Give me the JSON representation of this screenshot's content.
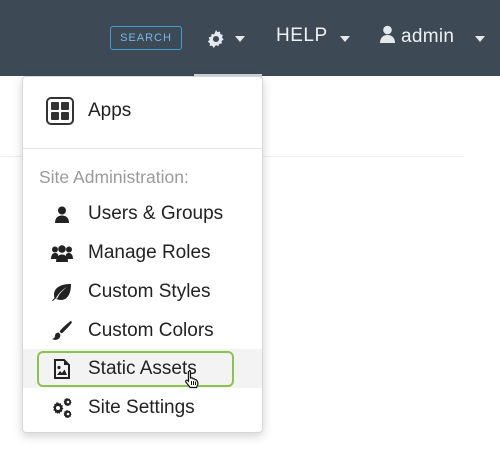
{
  "topbar": {
    "search_label": "SEARCH",
    "help_label": "HELP",
    "user_label": "admin"
  },
  "menu": {
    "apps_label": "Apps",
    "section_header": "Site Administration:",
    "items": [
      {
        "label": "Users & Groups",
        "icon": "user-icon"
      },
      {
        "label": "Manage Roles",
        "icon": "users-icon"
      },
      {
        "label": "Custom Styles",
        "icon": "leaf-icon"
      },
      {
        "label": "Custom Colors",
        "icon": "paintbrush-icon"
      },
      {
        "label": "Static Assets",
        "icon": "image-file-icon"
      },
      {
        "label": "Site Settings",
        "icon": "gears-icon"
      }
    ],
    "hovered_item": "Static Assets",
    "focus_color": "#8cc34f"
  },
  "colors": {
    "topbar_bg": "#3d4a55",
    "search_border": "#3f9fd2"
  }
}
